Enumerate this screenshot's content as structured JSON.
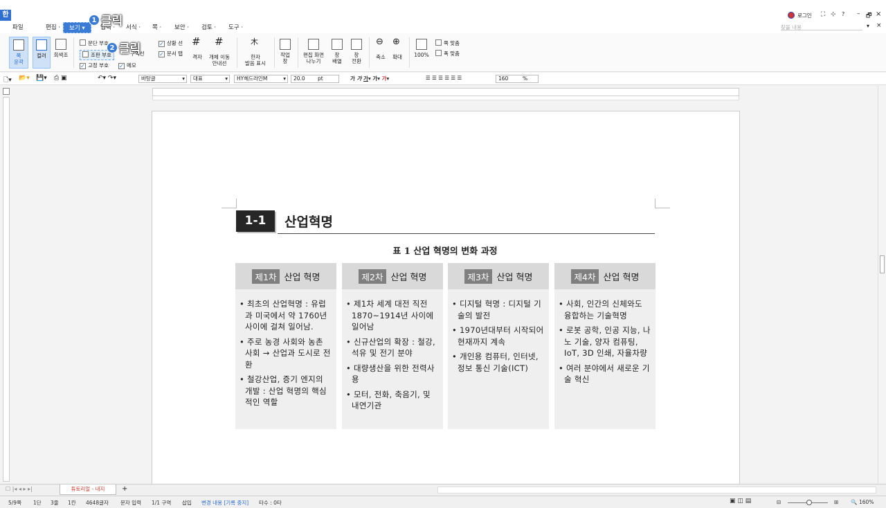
{
  "window": {
    "right_controls": [
      "로그인",
      "?"
    ],
    "search_placeholder": "찾을 내용"
  },
  "menus": [
    "파일",
    "편집",
    "보기",
    "입력",
    "서식",
    "쪽",
    "보안",
    "검토",
    "도구"
  ],
  "callouts": [
    {
      "num": "1",
      "text": "클릭"
    },
    {
      "num": "2",
      "text": "클릭"
    }
  ],
  "ribbon": {
    "page_outline": "쪽\n윤곽",
    "color": "컬러",
    "gray": "회색조",
    "checks": {
      "para_mark": "문단 부호",
      "layout_mark": "조판 부호",
      "fixed_mark": "고정 부호",
      "memo": "메모",
      "status_line": "상황 선",
      "doc_tab": "문서 탭",
      "grid_lines": "구역선"
    },
    "grid": "격자",
    "obj_move": "개체 이동\n안내선",
    "hanja": "한자\n발음 표시",
    "workspace": "작업\n창",
    "split": "편집 화면\n나누기",
    "arrange": "창\n배열",
    "switch": "창\n전환",
    "zoom_out": "축소",
    "zoom_in": "확대",
    "hundred": "100%",
    "fit_page": "쪽 맞춤",
    "fit_width": "폭 맞춤"
  },
  "toolbar": {
    "style": "바탕글",
    "lang": "대표",
    "font": "HY헤드라인M",
    "size": "20.0",
    "unit": "pt",
    "zoom": "160",
    "pct": "%"
  },
  "doc": {
    "section_no": "1-1",
    "section_title": "산업혁명",
    "table_caption": "표 1 산업 혁명의 변화 과정",
    "columns": [
      {
        "badge": "제1차",
        "title": "산업 혁명",
        "items": [
          "최초의 산업혁명 : 유럽과 미국에서 약 1760년사이에 걸쳐 일어남.",
          "주로 농경 사회와 농촌 사회 → 산업과 도시로 전환",
          "철강산업, 증기 엔지의 개발 : 산업 혁명의 핵심적인 역할"
        ]
      },
      {
        "badge": "제2차",
        "title": "산업 혁명",
        "items": [
          "제1차 세계 대전 직전 1870~1914년 사이에 일어남",
          "신규산업의 확장 : 철강, 석유 및 전기 분야",
          "대량생산을 위한 전력사용",
          "모터, 전화, 축음기, 및 내연기관"
        ]
      },
      {
        "badge": "제3차",
        "title": "산업 혁명",
        "items": [
          "디지털 혁명 : 디지털 기술의 발전",
          "1970년대부터 시작되어 현재까지 계속",
          "개인용 컴퓨터, 인터넷, 정보 통신 기술(ICT)"
        ]
      },
      {
        "badge": "제4차",
        "title": "산업 혁명",
        "items": [
          "사회, 인간의 신체와도 융합하는 기술혁명",
          "로봇 공학, 인공 지능, 나노 기술, 양자 컴퓨팅, IoT, 3D 인쇄, 자율차량",
          "여러 분야에서 새로운 기술 혁신"
        ]
      }
    ]
  },
  "tab": {
    "name": "튜토리얼 - 내지",
    "add": "+"
  },
  "status": [
    "5/9쪽",
    "1단",
    "3줄",
    "1칸",
    "4648글자",
    "문자 입력",
    "1/1 구역",
    "삽입",
    "변경 내용 [기록 중지]",
    "타수 : 0타"
  ],
  "status_zoom": "160%"
}
